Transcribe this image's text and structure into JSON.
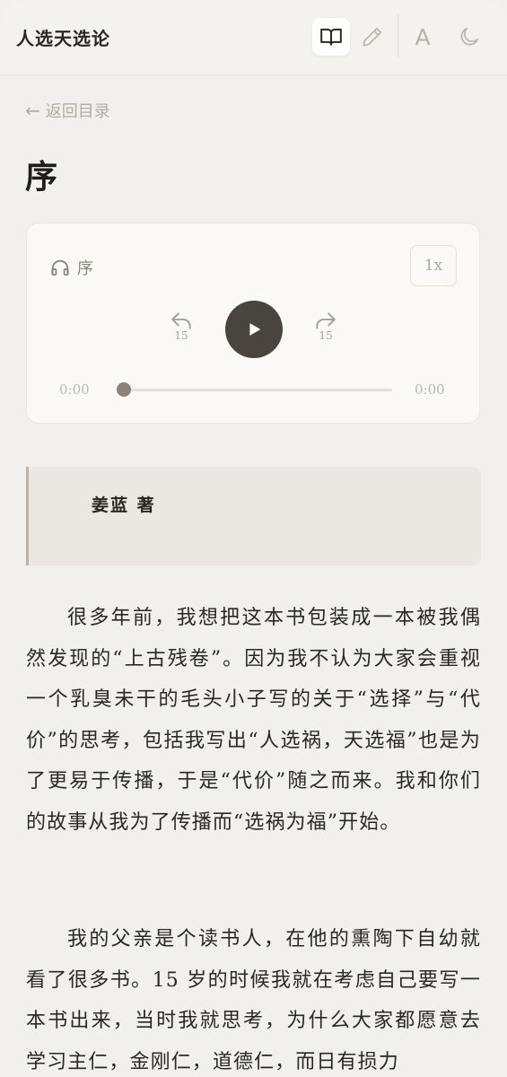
{
  "header": {
    "title": "人选天选论",
    "font_button_label": "A"
  },
  "nav": {
    "back_label": "返回目录"
  },
  "chapter": {
    "title": "序"
  },
  "audio": {
    "track_title": "序",
    "speed": "1x",
    "rewind_seconds": "15",
    "forward_seconds": "15",
    "current_time": "0:00",
    "duration": "0:00",
    "progress": 0
  },
  "book": {
    "author": "姜蓝 著"
  },
  "content": {
    "paragraphs": [
      "很多年前，我想把这本书包装成一本被我偶然发现的“上古残卷”。因为我不认为大家会重视一个乳臭未干的毛头小子写的关于“选择”与“代价”的思考，包括我写出“人选祸，天选福”也是为了更易于传播，于是“代价”随之而来。我和你们的故事从我为了传播而“选祸为福”开始。",
      "我的父亲是个读书人，在他的熏陶下自幼就看了很多书。15 岁的时候我就在考虑自己要写一本书出来，当时我就思考，为什么大家都愿意去学习主仁，金刚仁，道德仁，而日有损力"
    ]
  },
  "colors": {
    "background": "#f2f0ec",
    "play_button": "#4a443e",
    "accent_border": "#bfb3a6"
  }
}
